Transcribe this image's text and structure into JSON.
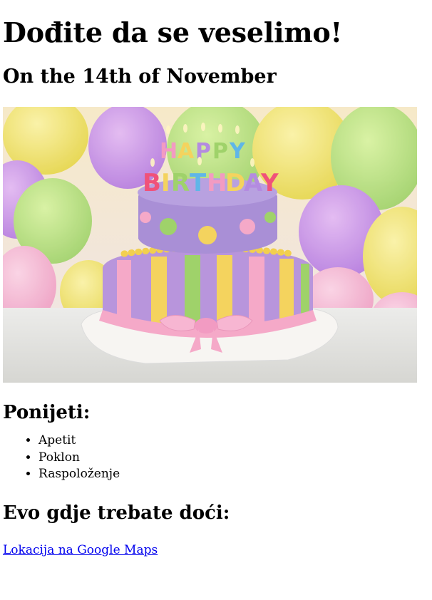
{
  "header": {
    "title": "Dođite da se veselimo!",
    "date": "On the 14th of November"
  },
  "image": {
    "subject": "birthday-cake-photo",
    "candle_text": "HAPPY BIRTHDAY",
    "colors": {
      "lavender": "#a98fd6",
      "pink": "#f5a9c8",
      "yellow": "#f4d35e",
      "green": "#9fd26a",
      "icing_white": "#f7f3f0"
    }
  },
  "bring": {
    "heading": "Ponijeti:",
    "items": [
      "Apetit",
      "Poklon",
      "Raspoloženje"
    ]
  },
  "location": {
    "heading": "Evo gdje trebate doći:",
    "link_text": "Lokacija na Google Maps",
    "link_color": "#0000ee"
  }
}
